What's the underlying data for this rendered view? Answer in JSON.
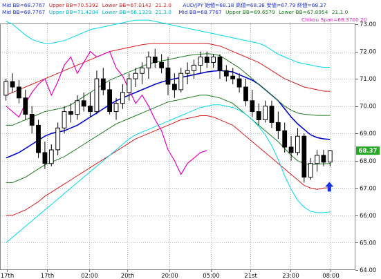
{
  "legend": {
    "line1": [
      {
        "text": "Mid BB=68.7767",
        "color": "#1f2fd6"
      },
      {
        "text": "Upper BB=70.5392",
        "color": "#d62020"
      },
      {
        "text": "Lower BB=67.0142",
        "color": "#d62020"
      },
      {
        "text": "21.2.0",
        "color": "#d62020"
      },
      {
        "text": "AUD/JPY 始値=68.18 高値=68.38 安値=67.79 終値=68.37",
        "color": "#1f2fd6"
      }
    ],
    "line2": [
      {
        "text": "Mid BB=68.7767",
        "color": "#1f2fd6"
      },
      {
        "text": "Upper BB=71.4204",
        "color": "#00b7c8"
      },
      {
        "text": "Lower BB=66.1329",
        "color": "#00b7c8"
      },
      {
        "text": "21.3.0",
        "color": "#00b7c8"
      },
      {
        "text": "Mid BB=68.7767",
        "color": "#1f2fd6"
      },
      {
        "text": "Upper BB=69.6579",
        "color": "#1c7a1c"
      },
      {
        "text": "Lower BB=67.8954",
        "color": "#1c7a1c"
      },
      {
        "text": "21.1.0",
        "color": "#1c7a1c"
      }
    ],
    "line3": [
      {
        "text": "Chikou Span=68.3700 20",
        "color": "#e020c0"
      }
    ]
  },
  "colors": {
    "mid": "#0000cc",
    "bb1": "#1c7a1c",
    "bb2": "#d81b1b",
    "bb3": "#00d8ee",
    "chikou": "#e800c0",
    "candle": "#000000",
    "grid": "#777777",
    "arrow": "#1a35e0",
    "last_price_bg": "#28a828"
  },
  "chart_data": {
    "type": "candlestick",
    "symbol": "AUD/JPY",
    "ylim": [
      64.0,
      73.0
    ],
    "y_ticks": [
      "73.00",
      "72.00",
      "71.00",
      "70.00",
      "69.00",
      "68.00",
      "67.00",
      "66.00",
      "65.00",
      "64.00"
    ],
    "x_tick_labels": [
      "17th",
      "17th",
      "02:00",
      "20th",
      "20:00",
      "05:00",
      "21st",
      "23:00",
      "08:00"
    ],
    "last_price_label": "68.37",
    "ohlc": [
      [
        70.4,
        71.0,
        70.2,
        70.9
      ],
      [
        70.9,
        71.2,
        70.5,
        70.7
      ],
      [
        70.7,
        70.95,
        70.1,
        70.3
      ],
      [
        70.3,
        70.6,
        69.5,
        69.7
      ],
      [
        69.7,
        70.0,
        69.0,
        69.3
      ],
      [
        69.3,
        69.5,
        68.1,
        68.3
      ],
      [
        68.3,
        68.7,
        67.7,
        67.9
      ],
      [
        67.9,
        68.6,
        67.8,
        68.4
      ],
      [
        68.4,
        69.4,
        68.2,
        69.2
      ],
      [
        69.2,
        70.0,
        69.0,
        69.8
      ],
      [
        69.8,
        70.1,
        69.4,
        69.7
      ],
      [
        69.7,
        70.4,
        69.5,
        70.2
      ],
      [
        70.2,
        70.5,
        69.8,
        70.0
      ],
      [
        70.0,
        70.5,
        69.6,
        69.8
      ],
      [
        69.8,
        71.3,
        69.7,
        71.0
      ],
      [
        71.0,
        71.4,
        70.4,
        70.6
      ],
      [
        70.6,
        70.9,
        69.7,
        69.8
      ],
      [
        69.8,
        70.3,
        69.5,
        70.1
      ],
      [
        70.1,
        70.8,
        69.9,
        70.5
      ],
      [
        70.5,
        71.2,
        70.2,
        71.0
      ],
      [
        71.0,
        71.4,
        70.7,
        71.2
      ],
      [
        71.2,
        71.6,
        70.8,
        71.4
      ],
      [
        71.4,
        72.0,
        71.0,
        71.8
      ],
      [
        71.8,
        72.1,
        71.4,
        71.6
      ],
      [
        71.6,
        71.9,
        71.2,
        71.4
      ],
      [
        71.4,
        71.8,
        70.4,
        70.8
      ],
      [
        70.8,
        71.2,
        70.3,
        70.6
      ],
      [
        70.6,
        71.4,
        70.5,
        71.2
      ],
      [
        71.2,
        71.6,
        70.8,
        71.3
      ],
      [
        71.3,
        71.7,
        71.0,
        71.5
      ],
      [
        71.5,
        72.0,
        71.2,
        71.8
      ],
      [
        71.8,
        72.0,
        71.4,
        71.6
      ],
      [
        71.6,
        71.9,
        71.4,
        71.8
      ],
      [
        71.8,
        71.9,
        71.0,
        71.3
      ],
      [
        71.3,
        71.5,
        70.9,
        71.1
      ],
      [
        71.1,
        71.4,
        70.8,
        71.0
      ],
      [
        71.0,
        71.2,
        70.5,
        70.7
      ],
      [
        70.7,
        71.0,
        70.0,
        70.2
      ],
      [
        70.2,
        70.6,
        69.6,
        69.8
      ],
      [
        69.8,
        70.1,
        69.3,
        69.5
      ],
      [
        69.5,
        70.2,
        69.4,
        70.0
      ],
      [
        70.0,
        70.2,
        69.2,
        69.4
      ],
      [
        69.4,
        69.8,
        68.8,
        69.1
      ],
      [
        69.1,
        69.4,
        68.3,
        68.5
      ],
      [
        68.5,
        68.9,
        68.0,
        68.3
      ],
      [
        68.3,
        69.2,
        68.2,
        68.9
      ],
      [
        68.9,
        69.0,
        67.2,
        67.4
      ],
      [
        67.4,
        68.1,
        67.3,
        67.9
      ],
      [
        67.9,
        68.4,
        67.6,
        68.2
      ],
      [
        68.2,
        68.4,
        67.8,
        67.95
      ],
      [
        67.95,
        68.4,
        67.79,
        68.37
      ]
    ],
    "series": [
      {
        "name": "Mid BB",
        "values": [
          68.1,
          68.2,
          68.3,
          68.45,
          68.6,
          68.75,
          68.9,
          69.0,
          69.05,
          69.1,
          69.2,
          69.3,
          69.45,
          69.6,
          69.75,
          69.9,
          70.05,
          70.2,
          70.3,
          70.4,
          70.5,
          70.6,
          70.7,
          70.8,
          70.88,
          70.95,
          71.0,
          71.05,
          71.1,
          71.15,
          71.2,
          71.25,
          71.28,
          71.3,
          71.28,
          71.25,
          71.15,
          71.05,
          70.95,
          70.8,
          70.6,
          70.4,
          70.2,
          69.9,
          69.6,
          69.35,
          69.15,
          68.95,
          68.85,
          68.8,
          68.78
        ]
      },
      {
        "name": "Upper BB 1",
        "values": [
          69.3,
          69.3,
          69.4,
          69.5,
          69.6,
          69.7,
          69.8,
          69.85,
          69.9,
          69.95,
          70.05,
          70.2,
          70.35,
          70.5,
          70.65,
          70.8,
          70.95,
          71.05,
          71.15,
          71.25,
          71.35,
          71.45,
          71.55,
          71.6,
          71.65,
          71.7,
          71.75,
          71.8,
          71.85,
          71.88,
          71.9,
          71.92,
          71.9,
          71.85,
          71.7,
          71.55,
          71.4,
          71.2,
          71.0,
          70.8,
          70.6,
          70.4,
          70.2,
          70.0,
          69.85,
          69.75,
          69.7,
          69.68,
          69.66,
          69.66,
          69.66
        ]
      },
      {
        "name": "Lower BB 1",
        "values": [
          67.2,
          67.2,
          67.3,
          67.4,
          67.55,
          67.7,
          67.85,
          67.95,
          68.05,
          68.15,
          68.3,
          68.45,
          68.6,
          68.75,
          68.9,
          69.05,
          69.2,
          69.35,
          69.45,
          69.55,
          69.65,
          69.75,
          69.85,
          69.95,
          70.05,
          70.15,
          70.2,
          70.25,
          70.3,
          70.35,
          70.4,
          70.4,
          70.35,
          70.3,
          70.2,
          70.1,
          69.9,
          69.7,
          69.5,
          69.3,
          69.1,
          68.9,
          68.7,
          68.45,
          68.2,
          68.0,
          67.9,
          67.85,
          67.88,
          67.89,
          67.9
        ]
      },
      {
        "name": "Upper BB 2",
        "values": [
          70.4,
          70.5,
          70.6,
          70.7,
          70.8,
          70.9,
          71.0,
          71.1,
          71.2,
          71.3,
          71.4,
          71.5,
          71.6,
          71.7,
          71.8,
          71.9,
          72.0,
          72.05,
          72.1,
          72.15,
          72.2,
          72.25,
          72.28,
          72.3,
          72.3,
          72.3,
          72.3,
          72.3,
          72.3,
          72.3,
          72.3,
          72.3,
          72.25,
          72.2,
          72.1,
          72.0,
          71.9,
          71.8,
          71.7,
          71.6,
          71.45,
          71.3,
          71.15,
          71.0,
          70.9,
          70.8,
          70.7,
          70.65,
          70.6,
          70.55,
          70.54
        ]
      },
      {
        "name": "Lower BB 2",
        "values": [
          66.0,
          66.0,
          66.1,
          66.2,
          66.35,
          66.5,
          66.7,
          66.85,
          67.0,
          67.15,
          67.3,
          67.45,
          67.6,
          67.75,
          67.9,
          68.05,
          68.2,
          68.35,
          68.5,
          68.65,
          68.8,
          68.9,
          69.0,
          69.1,
          69.2,
          69.3,
          69.4,
          69.5,
          69.55,
          69.6,
          69.65,
          69.65,
          69.6,
          69.5,
          69.4,
          69.3,
          69.1,
          68.9,
          68.7,
          68.5,
          68.3,
          68.1,
          67.9,
          67.7,
          67.5,
          67.3,
          67.1,
          67.0,
          66.95,
          67.0,
          67.01
        ]
      },
      {
        "name": "Upper BB 3",
        "values": [
          73.1,
          73.0,
          72.8,
          72.6,
          72.45,
          72.35,
          72.3,
          72.3,
          72.35,
          72.4,
          72.5,
          72.6,
          72.7,
          72.8,
          72.85,
          72.9,
          72.95,
          73.0,
          73.05,
          73.1,
          73.15,
          73.15,
          73.15,
          73.1,
          73.05,
          73.0,
          72.95,
          72.9,
          72.85,
          72.8,
          72.75,
          72.7,
          72.65,
          72.6,
          72.55,
          72.5,
          72.45,
          72.4,
          72.35,
          72.3,
          72.2,
          72.05,
          71.9,
          71.8,
          71.7,
          71.6,
          71.55,
          71.5,
          71.45,
          71.42,
          71.42
        ]
      },
      {
        "name": "Lower BB 3",
        "values": [
          65.0,
          65.2,
          65.4,
          65.6,
          65.8,
          66.0,
          66.2,
          66.4,
          66.6,
          66.8,
          67.0,
          67.2,
          67.4,
          67.6,
          67.8,
          68.0,
          68.2,
          68.4,
          68.6,
          68.8,
          68.95,
          69.05,
          69.15,
          69.25,
          69.35,
          69.45,
          69.55,
          69.65,
          69.75,
          69.85,
          69.95,
          70.0,
          70.05,
          70.05,
          70.0,
          69.95,
          69.85,
          69.7,
          69.5,
          69.25,
          68.95,
          68.55,
          68.05,
          67.45,
          66.95,
          66.55,
          66.3,
          66.15,
          66.1,
          66.1,
          66.13
        ]
      },
      {
        "name": "Chikou Span",
        "values": [
          70.0,
          69.8,
          69.6,
          70.1,
          70.5,
          70.8,
          71.0,
          70.4,
          70.9,
          71.5,
          71.8,
          71.2,
          71.6,
          72.0,
          71.8,
          71.9,
          72.0,
          71.4,
          71.1,
          70.6,
          70.1,
          70.4,
          70.0,
          69.5,
          69.1,
          68.4,
          68.0,
          67.5,
          67.9,
          68.1,
          68.3,
          68.37
        ]
      }
    ]
  }
}
